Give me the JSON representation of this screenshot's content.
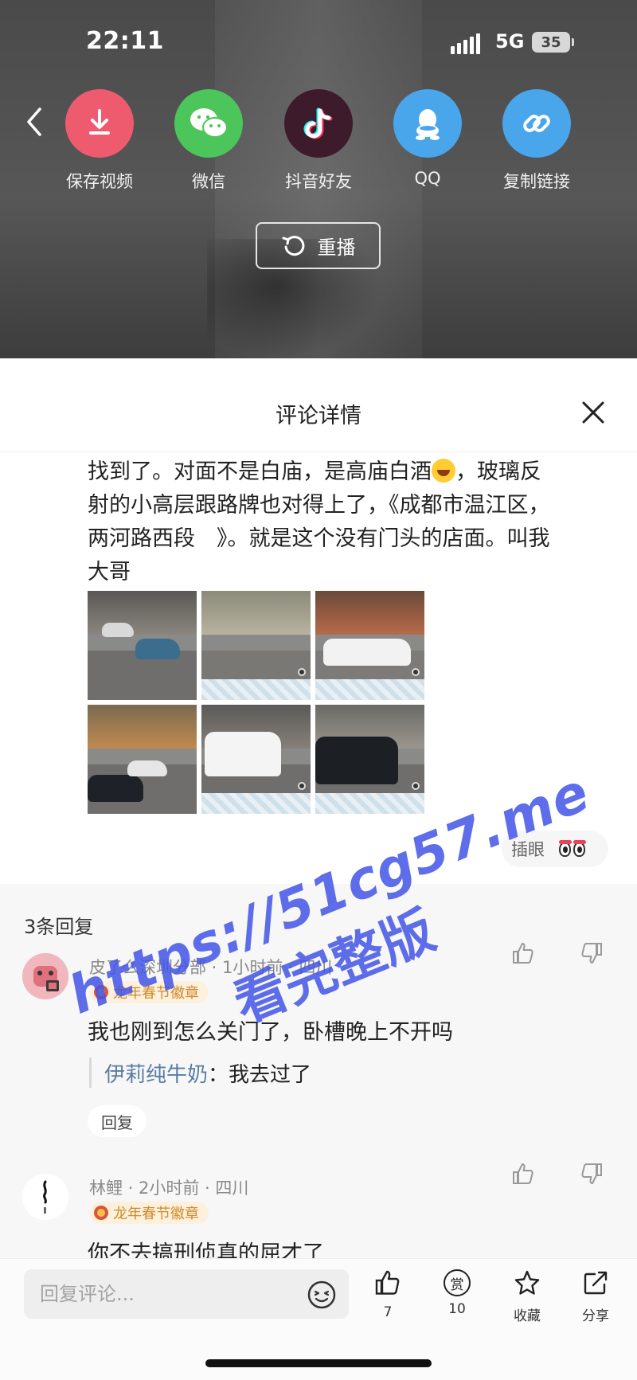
{
  "status_bar": {
    "time": "22:11",
    "network": "5G",
    "battery": "35"
  },
  "share_panel": {
    "items": [
      {
        "label": "保存视频",
        "icon": "download-icon",
        "color": "#ef5b6e"
      },
      {
        "label": "微信",
        "icon": "wechat-icon",
        "color": "#4cc55a"
      },
      {
        "label": "抖音好友",
        "icon": "douyin-icon",
        "color": "#3d1b2a"
      },
      {
        "label": "QQ",
        "icon": "qq-icon",
        "color": "#4aa6ea"
      },
      {
        "label": "复制链接",
        "icon": "link-icon",
        "color": "#4aa6ea"
      }
    ],
    "replay_label": "重播"
  },
  "sheet": {
    "title": "评论详情"
  },
  "comment": {
    "line1": "找到了。对面不是白庙，是高庙白酒",
    "line1_tail": "，玻璃反",
    "line2": "射的小高层跟路牌也对得上了，《成都市温江区，",
    "line3": "两河路西段　》。就是这个没有门头的店面。叫我",
    "line4": "大哥",
    "photo_count": 6,
    "reaction_label": "插眼"
  },
  "replies": {
    "count_label": "3条回复",
    "items": [
      {
        "username": "皮了么深圳分部",
        "meta": " · 1小时前 · 四川",
        "badge": "龙年春节徽章",
        "text": "我也刚到怎么关门了，卧槽晚上不开吗",
        "quote_author": "伊莉纯牛奶",
        "quote_text": "：我去过了",
        "reply_button": "回复"
      },
      {
        "username": "林鲤",
        "meta": " · 2小时前 · 四川",
        "badge": "龙年春节徽章",
        "text": "你不去搞刑侦真的屈才了"
      }
    ]
  },
  "bottom_bar": {
    "input_placeholder": "回复评论...",
    "like_count": "7",
    "tip_count": "10",
    "tip_icon_char": "赏",
    "collect_label": "收藏",
    "share_label": "分享"
  },
  "watermark": {
    "line1": "https://51cg57.me",
    "line2": "看完整版"
  }
}
